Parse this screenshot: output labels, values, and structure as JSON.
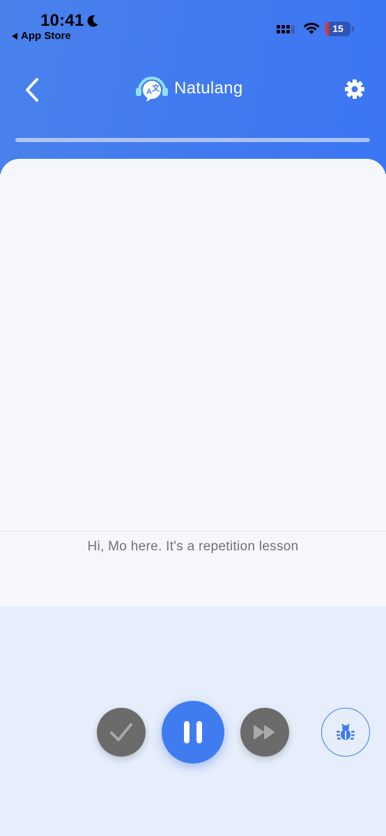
{
  "status_bar": {
    "time": "10:41",
    "back_label": "App Store",
    "battery_level": "15",
    "battery_fraction": 0.15
  },
  "header": {
    "app_name": "Natulang",
    "lesson_progress_percent": 0
  },
  "lesson": {
    "subtitle": "Hi, Mo here. It's a repetition lesson"
  },
  "controls": [
    "check",
    "pause",
    "skip",
    "report-bug"
  ],
  "colors": {
    "header_blue": "#4079f0",
    "accent_blue": "#3f7cf0",
    "control_gray": "#6b6b6b",
    "card_bg": "#f5f7fa",
    "page_bg": "#e6edfb"
  },
  "icons": {
    "nav_back": "chevron-left-icon",
    "settings": "gear-icon",
    "check": "check-icon",
    "pause": "pause-icon",
    "skip": "fast-forward-icon",
    "bug": "bug-icon",
    "logo": "headset-translate-logo"
  }
}
